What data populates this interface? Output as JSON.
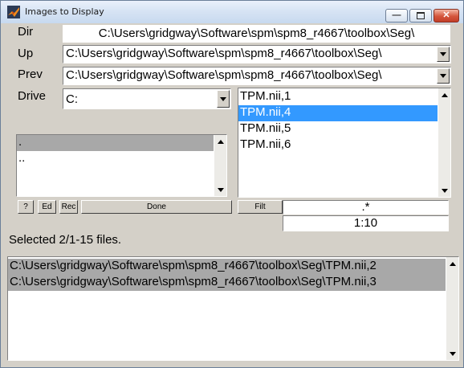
{
  "window": {
    "title": "Images to Display"
  },
  "labels": {
    "dir": "Dir",
    "up": "Up",
    "prev": "Prev",
    "drive": "Drive"
  },
  "dir": {
    "value": "C:\\Users\\gridgway\\Software\\spm\\spm8_r4667\\toolbox\\Seg\\"
  },
  "up": {
    "value": "C:\\Users\\gridgway\\Software\\spm\\spm8_r4667\\toolbox\\Seg\\"
  },
  "prev": {
    "value": "C:\\Users\\gridgway\\Software\\spm\\spm8_r4667\\toolbox\\Seg\\"
  },
  "drive": {
    "value": "C:"
  },
  "dir_list": {
    "items": [
      ".",
      ".."
    ]
  },
  "file_list": {
    "items": [
      "TPM.nii,1",
      "TPM.nii,4",
      "TPM.nii,5",
      "TPM.nii,6"
    ]
  },
  "buttons": {
    "help": "?",
    "edit": "Ed",
    "recursive": "Rec",
    "done": "Done",
    "filter": "Filt"
  },
  "filter": {
    "value": ".*"
  },
  "frames": {
    "value": "1:10"
  },
  "status": {
    "text": "Selected 2/1-15 files."
  },
  "selected_list": {
    "items": [
      "C:\\Users\\gridgway\\Software\\spm\\spm8_r4667\\toolbox\\Seg\\TPM.nii,2",
      "C:\\Users\\gridgway\\Software\\spm\\spm8_r4667\\toolbox\\Seg\\TPM.nii,3"
    ]
  },
  "colors": {
    "selection_blue": "#3399ff",
    "selection_gray": "#a8a8a8",
    "face": "#d4d0c8"
  }
}
